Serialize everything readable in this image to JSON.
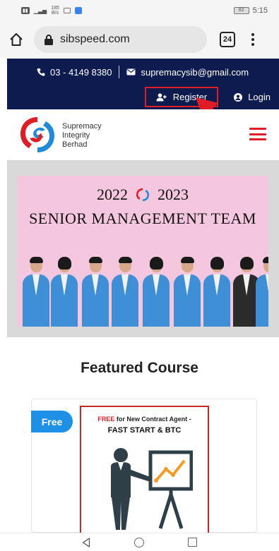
{
  "status_bar": {
    "speed_top": "185",
    "speed_bottom": "B/s",
    "battery": "82",
    "time": "5:15"
  },
  "browser": {
    "url": "sibspeed.com",
    "tab_count": "24"
  },
  "topbar": {
    "phone": "03 - 4149 8380",
    "email": "supremacysib@gmail.com",
    "register_label": "Register",
    "login_label": "Login"
  },
  "brand": {
    "line1": "Supremacy",
    "line2": "Integrity",
    "line3": "Berhad"
  },
  "banner": {
    "year_start": "2022",
    "year_end": "2023",
    "title": "SENIOR MANAGEMENT TEAM"
  },
  "featured": {
    "heading": "Featured Course",
    "badge": "Free",
    "image_line1_free": "FREE",
    "image_line1_rest": "for New Contract Agent -",
    "image_line2": "FAST START & BTC"
  },
  "colors": {
    "topbar_bg": "#0d1b4f",
    "accent_red": "#e01c24",
    "badge_blue": "#1e90e6",
    "banner_pink": "#f5c7df"
  }
}
